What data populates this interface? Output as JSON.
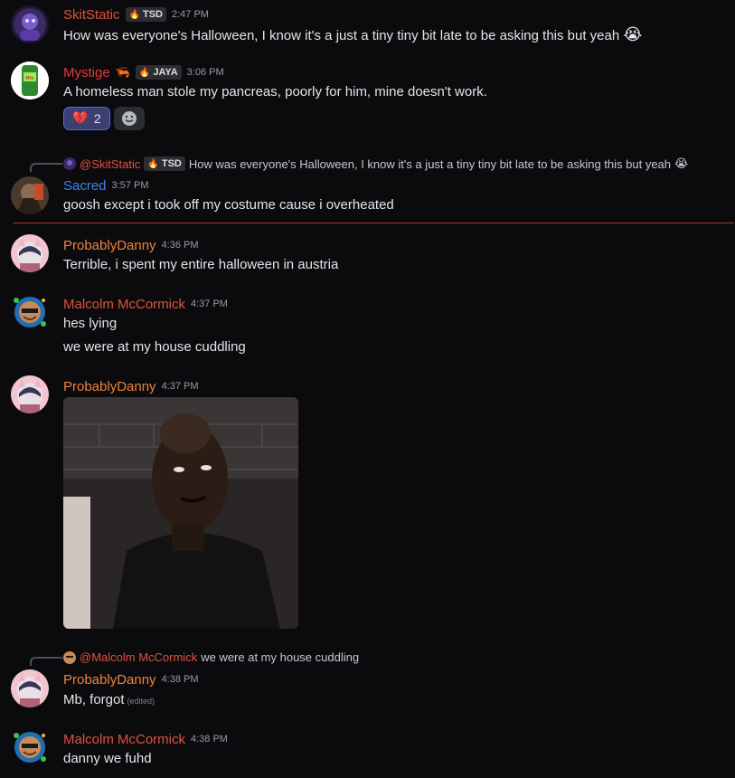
{
  "messages": [
    {
      "author": "SkitStatic",
      "author_color": "#e0533d",
      "tag": "TSD",
      "time": "2:47 PM",
      "text": "How was everyone's Halloween, I know it's a just a tiny tiny bit late to be asking this but yeah",
      "emoji": "😭"
    },
    {
      "author": "Mystige",
      "author_color": "#e03b3b",
      "badge_emoji": "🦐",
      "tag": "JAYA",
      "time": "3:06 PM",
      "text": "A homeless man stole my pancreas, poorly for him, mine doesn't work.",
      "reaction": {
        "emoji": "💔",
        "count": "2"
      }
    },
    {
      "reply_mention": "@SkitStatic",
      "reply_tag": "TSD",
      "reply_text": "How was everyone's Halloween, I know it's a just a tiny tiny bit late to be asking this but yeah",
      "reply_emoji": "😭",
      "author": "Sacred",
      "author_color": "#3b82f6",
      "time": "3:57 PM",
      "text": "goosh except i took off my costume cause i overheated"
    },
    {
      "author": "ProbablyDanny",
      "author_color": "#f0823c",
      "time": "4:36 PM",
      "text": "Terrible, i spent my entire halloween in austria"
    },
    {
      "author": "Malcolm McCormick",
      "author_color": "#e0533d",
      "time": "4:37 PM",
      "text": "hes lying",
      "text2": "we were at my house cuddling"
    },
    {
      "author": "ProbablyDanny",
      "author_color": "#f0823c",
      "time": "4:37 PM"
    },
    {
      "reply_mention": "@Malcolm McCormick",
      "reply_text": "we were at my house cuddling",
      "author": "ProbablyDanny",
      "author_color": "#f0823c",
      "time": "4:38 PM",
      "text": "Mb, forgot",
      "edited": "(edited)"
    },
    {
      "author": "Malcolm McCormick",
      "author_color": "#e0533d",
      "time": "4:38 PM",
      "text": "danny we fuhd"
    }
  ],
  "icons": {
    "add_reaction": "smiley-add-icon",
    "tag_icon": "flame-icon"
  }
}
